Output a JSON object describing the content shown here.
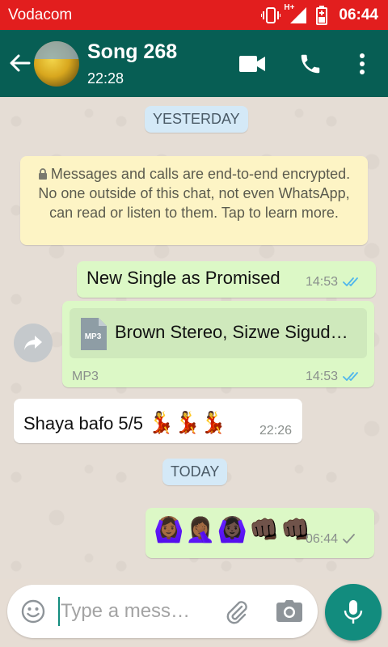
{
  "status_bar": {
    "carrier": "Vodacom",
    "network": "H+",
    "time": "06:44"
  },
  "header": {
    "contact_name": "Song 268",
    "contact_status": "22:28"
  },
  "chat": {
    "date_yesterday": "YESTERDAY",
    "encryption_notice": "Messages and calls are end-to-end encrypted. No one outside of this chat, not even WhatsApp, can read or listen to them. Tap to learn more.",
    "messages": [
      {
        "text": "New Single as Promised",
        "time": "14:53",
        "status": "read"
      },
      {
        "file_badge": "MP3",
        "file_name": "Brown Stereo, Sizwe Sigud…",
        "file_type": "MP3",
        "time": "14:53",
        "status": "read"
      },
      {
        "text": "Shaya bafo 5/5",
        "emoji": "💃💃💃",
        "time": "22:26"
      }
    ],
    "date_today": "TODAY",
    "today_message": {
      "emoji": "🙆🏾‍♀️🤦🏾‍♀️🙆🏿‍♀️👊🏿👊🏿",
      "time": "06:44",
      "status": "sent"
    }
  },
  "composer": {
    "placeholder": "Type a mess…"
  },
  "colors": {
    "status_bar": "#e21e1e",
    "app_bar": "#075e54",
    "outgoing_bubble": "#dcf8c6",
    "incoming_bubble": "#ffffff",
    "date_pill": "#d4e9f7",
    "notice": "#fdf4c5",
    "read_ticks": "#4fb6ec",
    "mic_button": "#128c7e"
  },
  "icons": [
    "vibrate-icon",
    "signal-icon",
    "battery-icon",
    "back-arrow-icon",
    "video-call-icon",
    "phone-icon",
    "more-vert-icon",
    "lock-icon",
    "forward-icon",
    "document-icon",
    "double-tick-icon",
    "single-tick-icon",
    "emoji-icon",
    "attach-icon",
    "camera-icon",
    "mic-icon"
  ]
}
